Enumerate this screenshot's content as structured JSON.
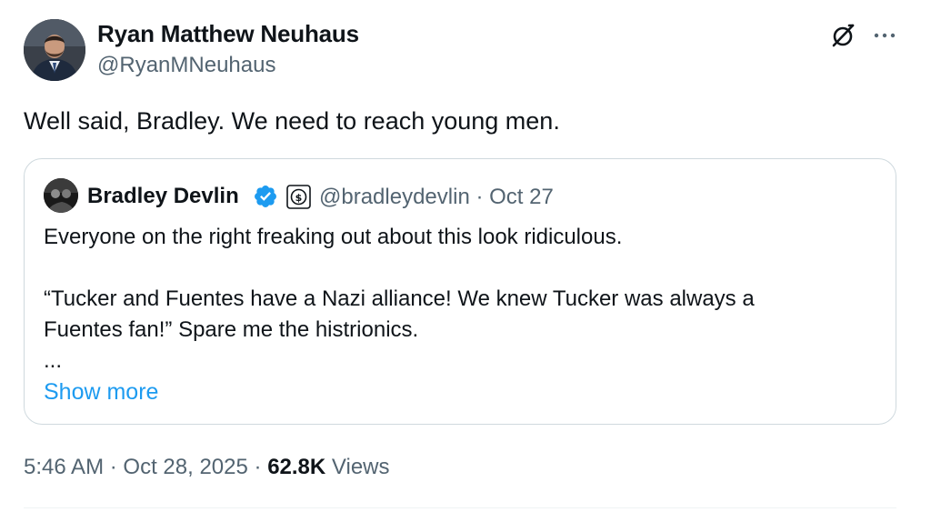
{
  "author": {
    "display_name": "Ryan Matthew Neuhaus",
    "handle": "@RyanMNeuhaus"
  },
  "tweet": {
    "text": "Well said, Bradley. We need to reach young men."
  },
  "quoted": {
    "display_name": "Bradley Devlin",
    "handle": "@bradleydevlin",
    "separator": "·",
    "date": "Oct 27",
    "lines": [
      "Everyone on the right freaking out about this look ridiculous.",
      "“Tucker and Fuentes have a Nazi alliance!  We knew Tucker was always a",
      "Fuentes fan!” Spare me the histrionics.",
      "..."
    ],
    "show_more": "Show more"
  },
  "meta": {
    "time": "5:46 AM",
    "date": "Oct 28, 2025",
    "separator": "·",
    "views_count": "62.8K",
    "views_label": "Views"
  },
  "colors": {
    "link": "#1d9bf0",
    "secondary_text": "#536471",
    "primary_text": "#0f1419",
    "border": "#cfd9de",
    "verified": "#1d9bf0"
  },
  "icons": {
    "grok": "grok-icon",
    "more": "more-icon",
    "verified": "verified-icon",
    "org_badge": "org-badge-icon"
  }
}
